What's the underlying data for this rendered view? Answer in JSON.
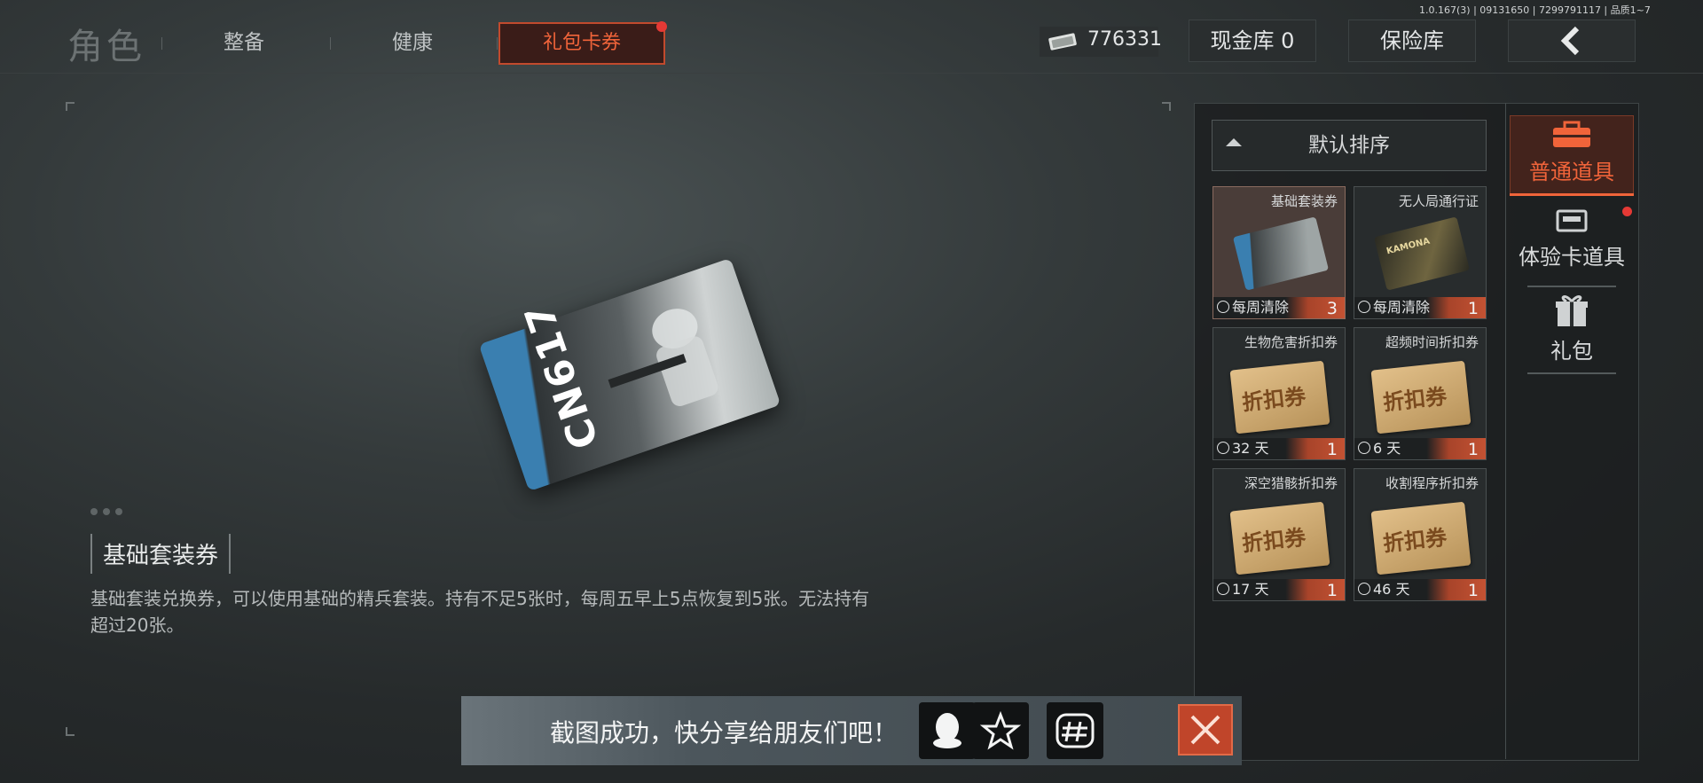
{
  "version": "1.0.167(3) | 09131650 | 7299791117 | 品质1~7",
  "header": {
    "title": "角色",
    "tabs": [
      "整备",
      "健康",
      "礼包卡券"
    ],
    "active_tab": "礼包卡券",
    "currency_value": "776331",
    "cash_vault_label": "现金库 0",
    "insurance_label": "保险库",
    "back_icon": "chevron-left-icon"
  },
  "selected_item": {
    "card_code": "CN617",
    "name": "基础套装券",
    "description": "基础套装兑换券，可以使用基础的精兵套装。持有不足5张时，每周五早上5点恢复到5张。无法持有超过20张。"
  },
  "inventory": {
    "sort_label": "默认排序",
    "items": [
      {
        "name": "基础套装券",
        "time": "每周清除",
        "count": "3",
        "selected": true
      },
      {
        "name": "无人局通行证",
        "time": "每周清除",
        "count": "1"
      },
      {
        "name": "生物危害折扣券",
        "time": "32 天",
        "count": "1",
        "coupon_text": "折扣券"
      },
      {
        "name": "超频时间折扣券",
        "time": "6 天",
        "count": "1",
        "coupon_text": "折扣券"
      },
      {
        "name": "深空猎骸折扣券",
        "time": "17 天",
        "count": "1",
        "coupon_text": "折扣券"
      },
      {
        "name": "收割程序折扣券",
        "time": "46 天",
        "count": "1",
        "coupon_text": "折扣券"
      }
    ],
    "thumb_text": "KAMONA"
  },
  "categories": [
    {
      "label": "普通道具",
      "icon": "toolbox-icon",
      "active": true
    },
    {
      "label": "体验卡道具",
      "icon": "card-icon",
      "badge": true
    },
    {
      "label": "礼包",
      "icon": "gift-icon"
    }
  ],
  "toast": {
    "message": "截图成功，快分享给朋友们吧！",
    "share_targets": [
      "qq-icon",
      "star-icon",
      "hashtag-icon"
    ],
    "close_icon": "close-icon"
  },
  "colors": {
    "accent": "#f1643a",
    "badge": "#e53935",
    "count_bg": "#c35233"
  }
}
